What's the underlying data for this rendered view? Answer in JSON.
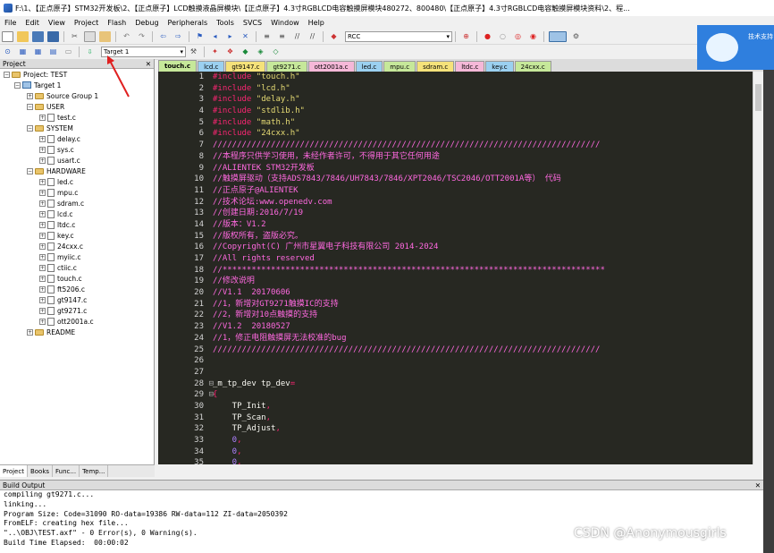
{
  "window": {
    "title": "F:\\1、【正点原子】STM32开发板\\2、【正点原子】LCD触摸液晶屏模块\\【正点原子】4.3寸RGBLCD电容触摸屏模块480272、800480\\【正点原子】4.3寸RGBLCD电容触摸屏模块资料\\2、程..."
  },
  "menu": [
    "File",
    "Edit",
    "View",
    "Project",
    "Flash",
    "Debug",
    "Peripherals",
    "Tools",
    "SVCS",
    "Window",
    "Help"
  ],
  "toolbar": {
    "target_combo": "Target 1",
    "find_combo": "RCC"
  },
  "project": {
    "header": "Project",
    "root": "Project: TEST",
    "target": "Target 1",
    "groups": [
      {
        "name": "Source Group 1",
        "files": []
      },
      {
        "name": "USER",
        "files": [
          "test.c"
        ]
      },
      {
        "name": "SYSTEM",
        "files": [
          "delay.c",
          "sys.c",
          "usart.c"
        ]
      },
      {
        "name": "HARDWARE",
        "files": [
          "led.c",
          "mpu.c",
          "sdram.c",
          "lcd.c",
          "ltdc.c",
          "key.c",
          "24cxx.c",
          "myiic.c",
          "ctiic.c",
          "touch.c",
          "ft5206.c",
          "gt9147.c",
          "gt9271.c",
          "ott2001a.c"
        ]
      },
      {
        "name": "README",
        "files": []
      }
    ],
    "tabs": [
      "Project",
      "Books",
      "Func...",
      "Temp..."
    ]
  },
  "editor": {
    "tabs": [
      {
        "label": "touch.c",
        "color": "#c6e89a",
        "active": true
      },
      {
        "label": "lcd.c",
        "color": "#9bd0f0"
      },
      {
        "label": "gt9147.c",
        "color": "#f5e27a"
      },
      {
        "label": "gt9271.c",
        "color": "#c6e89a"
      },
      {
        "label": "ott2001a.c",
        "color": "#f5b8d8"
      },
      {
        "label": "led.c",
        "color": "#9bd0f0"
      },
      {
        "label": "mpu.c",
        "color": "#c6e89a"
      },
      {
        "label": "sdram.c",
        "color": "#f5e27a"
      },
      {
        "label": "ltdc.c",
        "color": "#f5b8d8"
      },
      {
        "label": "key.c",
        "color": "#9bd0f0"
      },
      {
        "label": "24cxx.c",
        "color": "#c6e89a"
      }
    ],
    "lines": [
      [
        [
          "kw",
          "#include "
        ],
        [
          "str",
          "\"touch.h\""
        ]
      ],
      [
        [
          "kw",
          "#include "
        ],
        [
          "str",
          "\"lcd.h\""
        ]
      ],
      [
        [
          "kw",
          "#include "
        ],
        [
          "str",
          "\"delay.h\""
        ]
      ],
      [
        [
          "kw",
          "#include "
        ],
        [
          "str",
          "\"stdlib.h\""
        ]
      ],
      [
        [
          "kw",
          "#include "
        ],
        [
          "str",
          "\"math.h\""
        ]
      ],
      [
        [
          "kw",
          "#include "
        ],
        [
          "str",
          "\"24cxx.h\""
        ]
      ],
      [
        [
          "cm",
          "////////////////////////////////////////////////////////////////////////////////"
        ]
      ],
      [
        [
          "cm",
          "//本程序只供学习使用，未经作者许可，不得用于其它任何用途"
        ]
      ],
      [
        [
          "cm",
          "//ALIENTEK STM32开发板"
        ]
      ],
      [
        [
          "cm",
          "//触摸屏驱动（支持ADS7843/7846/UH7843/7846/XPT2046/TSC2046/OTT2001A等） 代码"
        ]
      ],
      [
        [
          "cm",
          "//正点原子@ALIENTEK"
        ]
      ],
      [
        [
          "cm",
          "//技术论坛:www.openedv.com"
        ]
      ],
      [
        [
          "cm",
          "//创建日期:2016/7/19"
        ]
      ],
      [
        [
          "cm",
          "//版本：V1.2"
        ]
      ],
      [
        [
          "cm",
          "//版权所有，盗版必究。"
        ]
      ],
      [
        [
          "cm",
          "//Copyright(C) 广州市星翼电子科技有限公司 2014-2024"
        ]
      ],
      [
        [
          "cm",
          "//All rights reserved"
        ]
      ],
      [
        [
          "cm",
          "//*******************************************************************************"
        ]
      ],
      [
        [
          "cm",
          "//修改说明"
        ]
      ],
      [
        [
          "cm",
          "//V1.1  20170606"
        ]
      ],
      [
        [
          "cm",
          "//1，新增对GT9271触摸IC的支持"
        ]
      ],
      [
        [
          "cm",
          "//2，新增对10点触摸的支持"
        ]
      ],
      [
        [
          "cm",
          "//V1.2  20180527"
        ]
      ],
      [
        [
          "cm",
          "//1，修正电阻触摸屏无法校准的bug"
        ]
      ],
      [
        [
          "cm",
          "////////////////////////////////////////////////////////////////////////////////"
        ]
      ],
      [],
      [],
      [
        [
          "pl",
          "_m_tp_dev tp_dev"
        ],
        [
          "kw",
          "="
        ]
      ],
      [
        [
          "kw",
          "{"
        ]
      ],
      [
        [
          "pl",
          "    TP_Init"
        ],
        [
          "kw",
          ","
        ]
      ],
      [
        [
          "pl",
          "    TP_Scan"
        ],
        [
          "kw",
          ","
        ]
      ],
      [
        [
          "pl",
          "    TP_Adjust"
        ],
        [
          "kw",
          ","
        ]
      ],
      [
        [
          "nm",
          "    0"
        ],
        [
          "kw",
          ","
        ]
      ],
      [
        [
          "nm",
          "    0"
        ],
        [
          "kw",
          ","
        ]
      ],
      [
        [
          "nm",
          "    0"
        ],
        [
          "kw",
          ","
        ]
      ]
    ]
  },
  "build": {
    "header": "Build Output",
    "lines": [
      "compiling gt9271.c...",
      "linking...",
      "Program Size: Code=31090 RO-data=19386 RW-data=112 ZI-data=2050392",
      "FromELF: creating hex file...",
      "\"..\\OBJ\\TEST.axf\" - 0 Error(s), 0 Warning(s).",
      "Build Time Elapsed:  00:00:02"
    ]
  },
  "float_widget": {
    "text": "技术支持"
  },
  "watermark": "CSDN @Anonymousgirls"
}
